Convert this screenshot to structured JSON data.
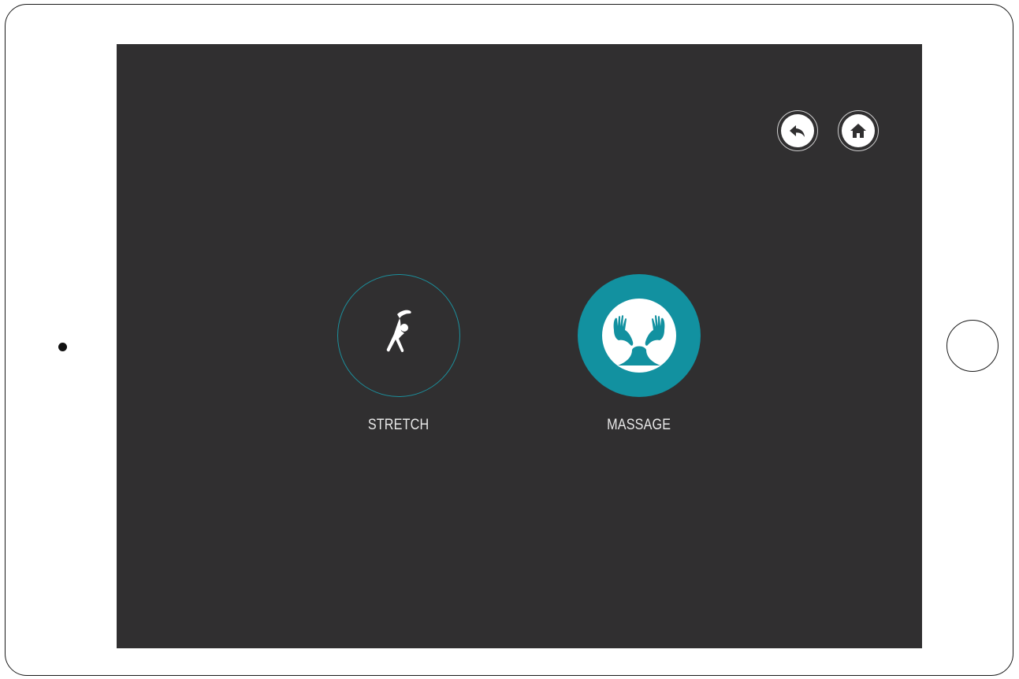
{
  "navigation": {
    "back_icon": "back-arrow-icon",
    "home_icon": "home-icon"
  },
  "options": [
    {
      "label": "STRETCH",
      "icon": "stretch-icon",
      "selected": false
    },
    {
      "label": "MASSAGE",
      "icon": "massage-hands-icon",
      "selected": true
    }
  ],
  "colors": {
    "screen_background": "#302f30",
    "accent": "#1291a0",
    "accent_border": "#1c8f9c",
    "label_text": "#e8e8e8"
  }
}
